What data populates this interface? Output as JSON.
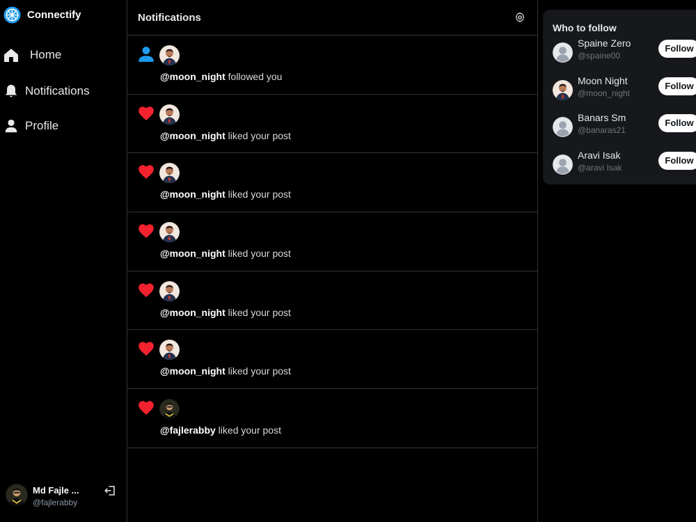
{
  "app": {
    "name": "Connectify"
  },
  "nav": {
    "home": "Home",
    "notifications": "Notifications",
    "profile": "Profile"
  },
  "current_user": {
    "name": "Md Fajle ...",
    "handle": "@fajlerabby"
  },
  "main": {
    "title": "Notifications"
  },
  "notifications": [
    {
      "type": "follow",
      "user": "@moon_night",
      "text": " followed you",
      "avatar": "moon"
    },
    {
      "type": "like",
      "user": "@moon_night",
      "text": " liked your post",
      "avatar": "moon"
    },
    {
      "type": "like",
      "user": "@moon_night",
      "text": " liked your post",
      "avatar": "moon"
    },
    {
      "type": "like",
      "user": "@moon_night",
      "text": " liked your post",
      "avatar": "moon"
    },
    {
      "type": "like",
      "user": "@moon_night",
      "text": " liked your post",
      "avatar": "moon"
    },
    {
      "type": "like",
      "user": "@moon_night",
      "text": " liked your post",
      "avatar": "moon"
    },
    {
      "type": "like",
      "user": "@fajlerabby",
      "text": " liked your post",
      "avatar": "fajle"
    }
  ],
  "who_to_follow": {
    "title": "Who to follow",
    "users": [
      {
        "name": "Spaine Zero",
        "handle": "@spaine00",
        "avatar": "default",
        "button": "Follow"
      },
      {
        "name": "Moon Night",
        "handle": "@moon_night",
        "avatar": "moon",
        "button": "Follow"
      },
      {
        "name": "Banars Sm",
        "handle": "@banaras21",
        "avatar": "default",
        "button": "Follow"
      },
      {
        "name": "Aravi Isak",
        "handle": "@aravi Isak",
        "avatar": "default",
        "button": "Follow"
      }
    ]
  },
  "colors": {
    "like": "#f4212e",
    "follow": "#1d9bf0",
    "brand": "#1d9bf0"
  }
}
